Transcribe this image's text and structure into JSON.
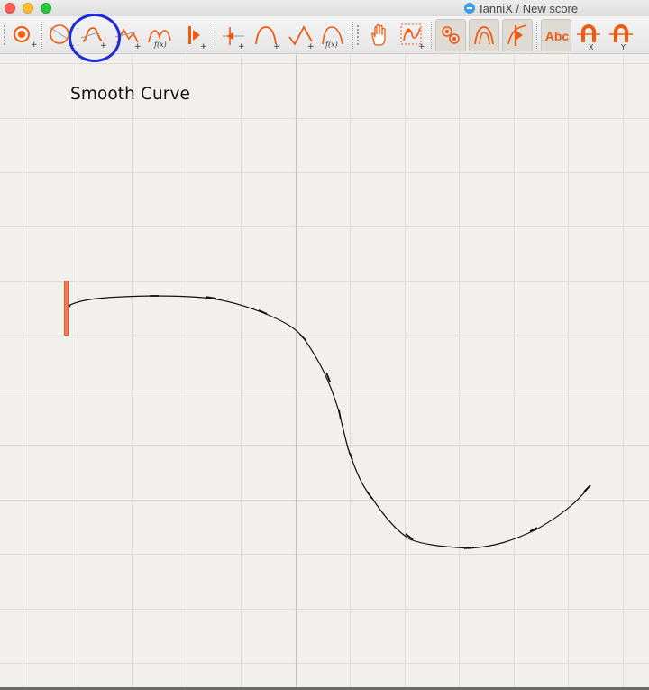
{
  "window": {
    "title": "IanniX / New score",
    "app_icon": "iannix-app-icon",
    "traffic_lights": [
      "close",
      "minimize",
      "zoom"
    ]
  },
  "toolbar": {
    "accent_color": "#f05a0f",
    "highlight_color": "#1f2bd6",
    "items": [
      {
        "name": "add-trigger",
        "icon": "target-plus-icon"
      },
      {
        "name": "add-circle-curve",
        "icon": "circle-plus-icon"
      },
      {
        "name": "add-smooth-curve",
        "icon": "smooth-curve-plus-icon",
        "highlighted": true
      },
      {
        "name": "add-straight-curve",
        "icon": "line-curve-plus-icon"
      },
      {
        "name": "add-math-curve",
        "icon": "fx-curve-plus-icon"
      },
      {
        "name": "add-cursor",
        "icon": "cursor-plus-icon"
      },
      {
        "name": "add-point-trigger",
        "icon": "point-plus-icon"
      },
      {
        "name": "add-smooth-timeline",
        "icon": "arc-plus-icon"
      },
      {
        "name": "add-straight-timeline",
        "icon": "peak-plus-icon"
      },
      {
        "name": "add-fx-timeline",
        "icon": "fx-arc-plus-icon"
      },
      {
        "name": "navigate-hand",
        "icon": "hand-icon"
      },
      {
        "name": "edit-points",
        "icon": "edit-curve-icon"
      },
      {
        "name": "view-triggers",
        "icon": "triggers-view-icon",
        "active": true
      },
      {
        "name": "view-curves",
        "icon": "curves-view-icon",
        "active": true
      },
      {
        "name": "view-cursors",
        "icon": "cursors-view-icon",
        "active": true
      },
      {
        "name": "toggle-labels",
        "icon": "text-icon",
        "label": "Abc",
        "active": true
      },
      {
        "name": "snap-x",
        "icon": "magnet-x-icon"
      },
      {
        "name": "snap-y",
        "icon": "magnet-y-icon"
      }
    ]
  },
  "canvas": {
    "background": "#f1f0ec",
    "grid_color": "#dcdbd6",
    "axis_color": "#c6c5c0",
    "curve_label": "Smooth Curve",
    "curve_color": "#111111",
    "cursor_color": "#f05a0f"
  }
}
